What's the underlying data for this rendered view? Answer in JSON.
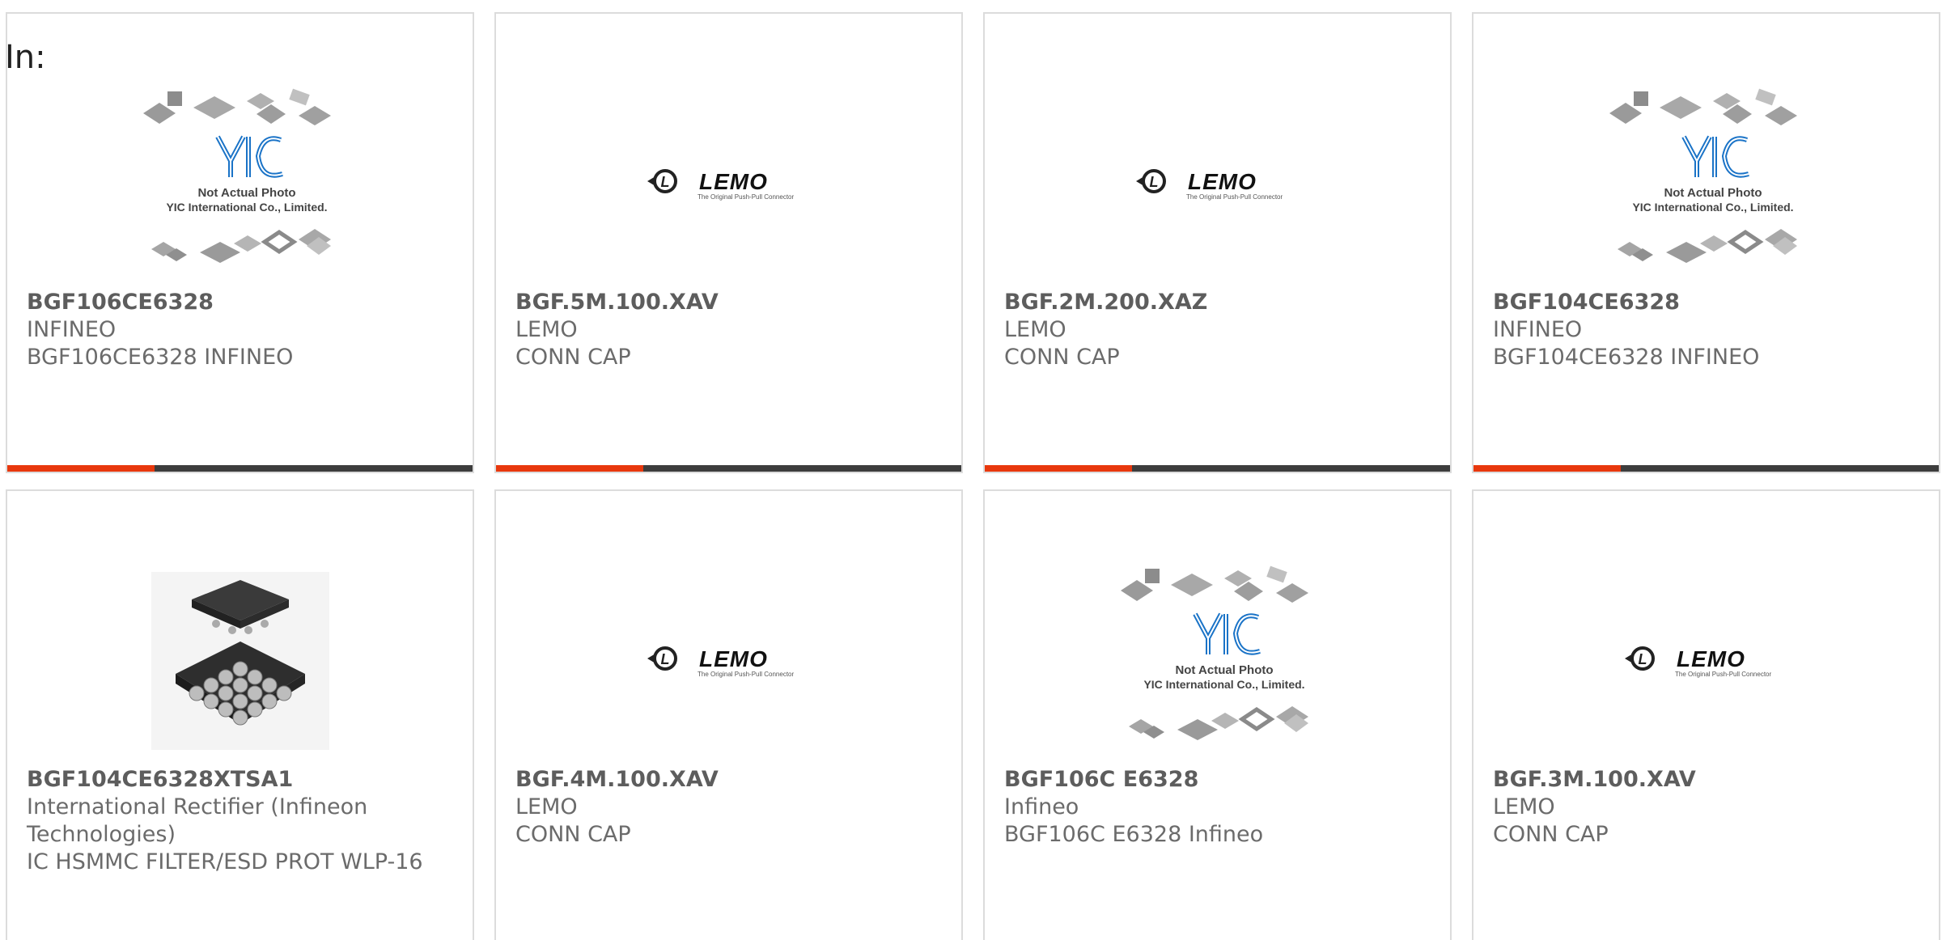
{
  "label": "In:",
  "products": [
    {
      "part": "BGF106CE6328",
      "maker": "INFINEO",
      "desc": "BGF106CE6328 INFINEO",
      "image": "yic-placeholder"
    },
    {
      "part": "BGF.5M.100.XAV",
      "maker": "LEMO",
      "desc": "CONN CAP",
      "image": "lemo-logo"
    },
    {
      "part": "BGF.2M.200.XAZ",
      "maker": "LEMO",
      "desc": "CONN CAP",
      "image": "lemo-logo"
    },
    {
      "part": "BGF104CE6328",
      "maker": "INFINEO",
      "desc": "BGF104CE6328 INFINEO",
      "image": "yic-placeholder"
    },
    {
      "part": "BGF104CE6328XTSA1",
      "maker": "International Rectifier (Infineon Technologies)",
      "desc": "IC HSMMC FILTER/ESD PROT WLP-16",
      "image": "bga-chip"
    },
    {
      "part": "BGF.4M.100.XAV",
      "maker": "LEMO",
      "desc": "CONN CAP",
      "image": "lemo-logo"
    },
    {
      "part": "BGF106C E6328",
      "maker": "Infineo",
      "desc": "BGF106C E6328 Infineo",
      "image": "yic-placeholder"
    },
    {
      "part": "BGF.3M.100.XAV",
      "maker": "LEMO",
      "desc": "CONN CAP",
      "image": "lemo-logo"
    }
  ],
  "yic": {
    "line1": "Not Actual Photo",
    "line2": "YIC International Co., Limited.",
    "logo": "YIC"
  },
  "lemo": {
    "brand": "LEMO",
    "tagline": "The Original Push-Pull Connector"
  },
  "colors": {
    "accent": "#e8380d",
    "bar": "#3d3d3d",
    "border": "#dcdcdc",
    "text": "#6b6b6b",
    "yic_blue": "#1a73c7"
  }
}
